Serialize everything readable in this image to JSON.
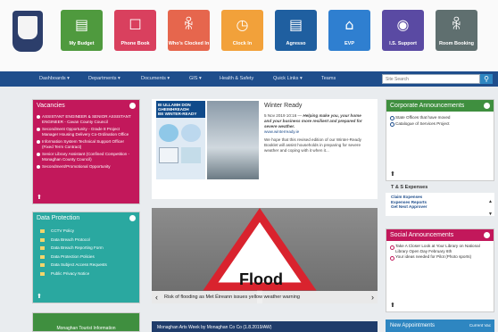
{
  "tiles": [
    {
      "label": "My Budget",
      "color": "#4f9a3e",
      "icon": "budget-icon",
      "glyph": "▤"
    },
    {
      "label": "Phone Book",
      "color": "#d9405e",
      "icon": "phonebook-icon",
      "glyph": "☐"
    },
    {
      "label": "Who's Clocked In",
      "color": "#e6664d",
      "icon": "people-icon",
      "glyph": "ꆜ"
    },
    {
      "label": "Clock In",
      "color": "#f2a13a",
      "icon": "clock-icon",
      "glyph": "◷"
    },
    {
      "label": "Agresso",
      "color": "#1f5fa0",
      "icon": "agresso-icon",
      "glyph": "▤"
    },
    {
      "label": "EVP",
      "color": "#2f7fd0",
      "icon": "building-icon",
      "glyph": "⌂"
    },
    {
      "label": "I.S. Support",
      "color": "#5a4aa3",
      "icon": "support-icon",
      "glyph": "◉"
    },
    {
      "label": "Room Booking",
      "color": "#5f6f6f",
      "icon": "rooms-icon",
      "glyph": "ꆜ"
    }
  ],
  "nav": [
    "Dashboards ▾",
    "Departments ▾",
    "Documents ▾",
    "GIS ▾",
    "Health & Safety",
    "Quick Links ▾",
    "Teams"
  ],
  "search": {
    "placeholder": "Site Search"
  },
  "vacancies": {
    "title": "Vacancies",
    "items": [
      "ASSISTANT ENGINEER & SENIOR ASSISTANT ENGINEER - Cavan County Council",
      "Secondment Opportunity - Grade 8 Project Manager Housing Delivery Co-Ordination Office",
      "Information System Technical Support Officer (Fixed Term Contract)",
      "Senior Library Assistant (Confined Competition - Monaghan County Council)",
      "Secondment/Promotional Opportunity"
    ]
  },
  "data_protection": {
    "title": "Data Protection",
    "items": [
      "CCTV Policy",
      "Data Breach Protocol",
      "Data Breach Reporting Form",
      "Data Protection Policies",
      "Data Subject Access Requests",
      "Public Privacy Notice"
    ]
  },
  "next_panel": {
    "title": "Monaghan Tourist Information"
  },
  "news": {
    "image_text": "BI ULLAMH DON GHEIMHREADH\nBE WINTER-READY",
    "title": "Winter Ready",
    "meta": "5 Nov 2019 10:16 —",
    "body": "Helping make you, your home and your business more resilient and prepared for severe weather.",
    "link": "www.winterready.ie",
    "text": "We hope that this revised edition of our Winter-Ready Booklet will assist households in preparing for severe weather and coping with it when it..."
  },
  "slider": {
    "caption": "Risk of flooding as Met Éireann issues yellow weather warning",
    "sign_text": "Flood"
  },
  "bottom_banner": {
    "title": "Monaghan Arts Week by Monaghan Co Co (1.8.2019/AW)"
  },
  "corporate": {
    "title": "Corporate Announcements",
    "items": [
      "State Offices that have moved",
      "Catalogue of Services Project"
    ]
  },
  "ts_expenses": {
    "title": "T & S Expenses",
    "links": [
      "Claim Expenses",
      "Expenses Reports",
      "Get Next Approver"
    ]
  },
  "social": {
    "title": "Social Announcements",
    "items": [
      "Take A Closer Look at Your Library on National Library Open Day February 6th",
      "Your ideas needed for Pilot (Photo sports)"
    ]
  },
  "new_appointments": {
    "title": "New Appointments",
    "extra": "Current Vac"
  },
  "colors": {
    "magenta": "#c2185b",
    "teal": "#2aa8a0",
    "navy": "#1f4e8c",
    "green": "#3f8f3f"
  }
}
